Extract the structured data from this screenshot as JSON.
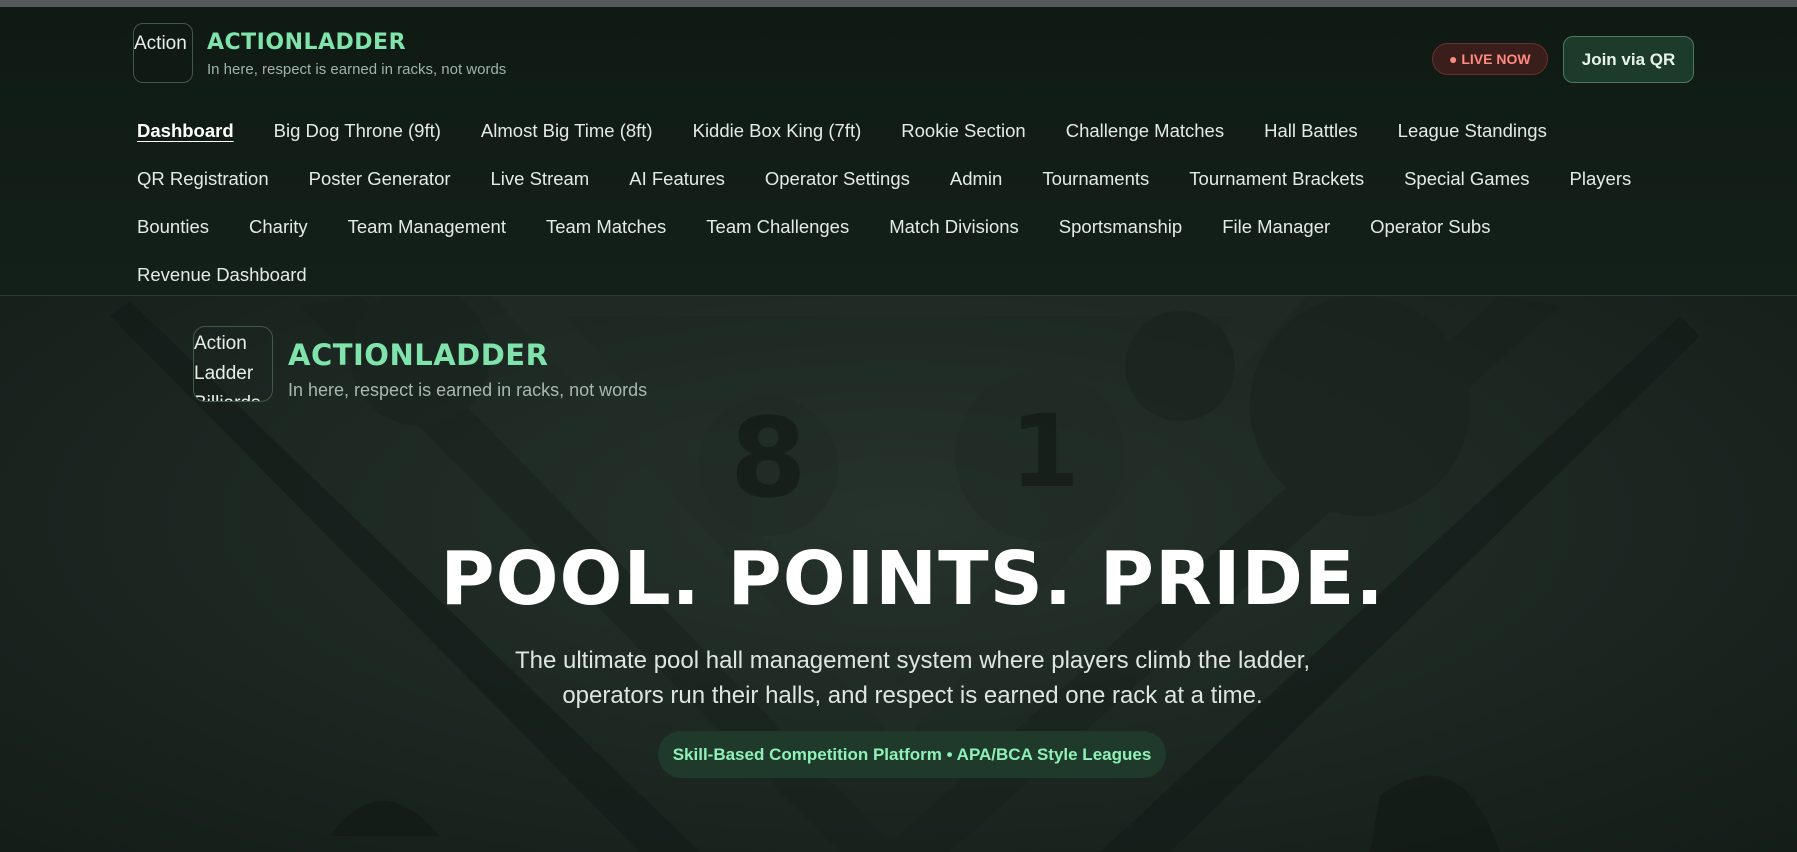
{
  "header": {
    "logo_alt": "Action",
    "brand_title": "ACTIONLADDER",
    "brand_tagline": "In here, respect is earned in racks, not words",
    "live_badge": "● LIVE NOW",
    "qr_button": "Join via QR"
  },
  "nav": {
    "rows": [
      [
        "Dashboard",
        "Big Dog Throne (9ft)",
        "Almost Big Time (8ft)",
        "Kiddie Box King (7ft)",
        "Rookie Section",
        "Challenge Matches",
        "Hall Battles",
        "League Standings"
      ],
      [
        "QR Registration",
        "Poster Generator",
        "Live Stream",
        "AI Features",
        "Operator Settings",
        "Admin",
        "Tournaments",
        "Tournament Brackets",
        "Special Games",
        "Players"
      ],
      [
        "Bounties",
        "Charity",
        "Team Management",
        "Team Matches",
        "Team Challenges",
        "Match Divisions",
        "Sportsmanship",
        "File Manager",
        "Operator Subs"
      ],
      [
        "Revenue Dashboard"
      ]
    ],
    "active": "Dashboard"
  },
  "hero": {
    "logo_alt": "Action Ladder Billiards",
    "brand_title": "ACTIONLADDER",
    "brand_tagline": "In here, respect is earned in racks, not words",
    "headline": "POOL. POINTS. PRIDE.",
    "lead_line1": "The ultimate pool hall management system where players climb the ladder,",
    "lead_line2": "operators run their halls, and respect is earned one rack at a time.",
    "pill": "Skill-Based Competition Platform • APA/BCA Style Leagues"
  },
  "colors": {
    "accent": "#7fe3ab",
    "live": "#ff8a80",
    "header_bg": "#0f1a14"
  }
}
